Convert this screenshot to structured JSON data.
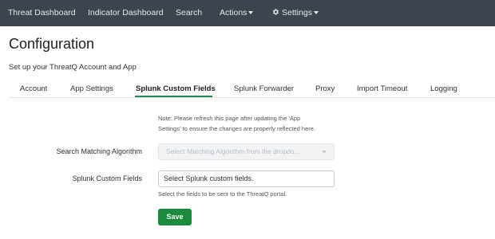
{
  "topnav": {
    "items": [
      {
        "label": "Threat Dashboard"
      },
      {
        "label": "Indicator Dashboard"
      },
      {
        "label": "Search"
      },
      {
        "label": "Actions"
      },
      {
        "label": "Settings"
      }
    ],
    "background": "#3c444d"
  },
  "page": {
    "title": "Configuration",
    "subtitle": "Set up your ThreatQ Account and App"
  },
  "tabs": [
    {
      "label": "Account"
    },
    {
      "label": "App Settings"
    },
    {
      "label": "Splunk Custom Fields",
      "active": true
    },
    {
      "label": "Splunk Forwarder"
    },
    {
      "label": "Proxy"
    },
    {
      "label": "Import Timeout"
    },
    {
      "label": "Logging"
    }
  ],
  "form": {
    "note_line1": "Note: Please refresh this page after updating the 'App",
    "note_line2": "Settings' to ensure the changes are properly reflected here.",
    "algorithm": {
      "label": "Search Matching Algorithm",
      "placeholder": "Select Matching Algorithm from the dropdo...",
      "disabled": true
    },
    "custom_fields": {
      "label": "Splunk Custom Fields",
      "placeholder": "Select Splunk custom fields.",
      "help": "Select the fields to be sent to the ThreatQ portal."
    },
    "save_label": "Save"
  },
  "colors": {
    "accent": "#1c8a4e",
    "save_button": "#1a8a3f"
  }
}
